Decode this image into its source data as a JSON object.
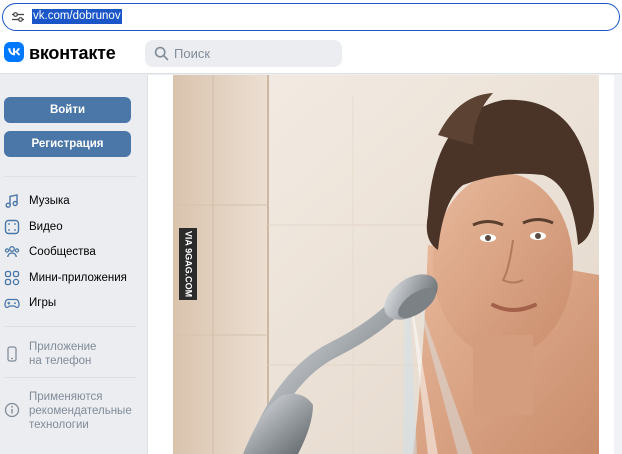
{
  "browser": {
    "url": "vk.com/dobrunov"
  },
  "header": {
    "logo_text": "вконтакте",
    "search_placeholder": "Поиск"
  },
  "sidebar": {
    "login_label": "Войти",
    "register_label": "Регистрация",
    "items": [
      {
        "label": "Музыка",
        "icon": "music-icon"
      },
      {
        "label": "Видео",
        "icon": "video-icon"
      },
      {
        "label": "Сообщества",
        "icon": "communities-icon"
      },
      {
        "label": "Мини-приложения",
        "icon": "mini-apps-icon"
      },
      {
        "label": "Игры",
        "icon": "gamepad-icon"
      }
    ],
    "app_promo": {
      "line1": "Приложение",
      "line2": "на телефон",
      "icon": "phone-icon"
    },
    "recommended": {
      "line1": "Применяются",
      "line2": "рекомендательные",
      "line3": "технологии",
      "icon": "info-icon"
    }
  },
  "post": {
    "watermark": "VIA 9GAG.COM"
  },
  "colors": {
    "accent": "#0077ff",
    "button": "#4a76a8",
    "url_highlight": "#1a56c8"
  }
}
